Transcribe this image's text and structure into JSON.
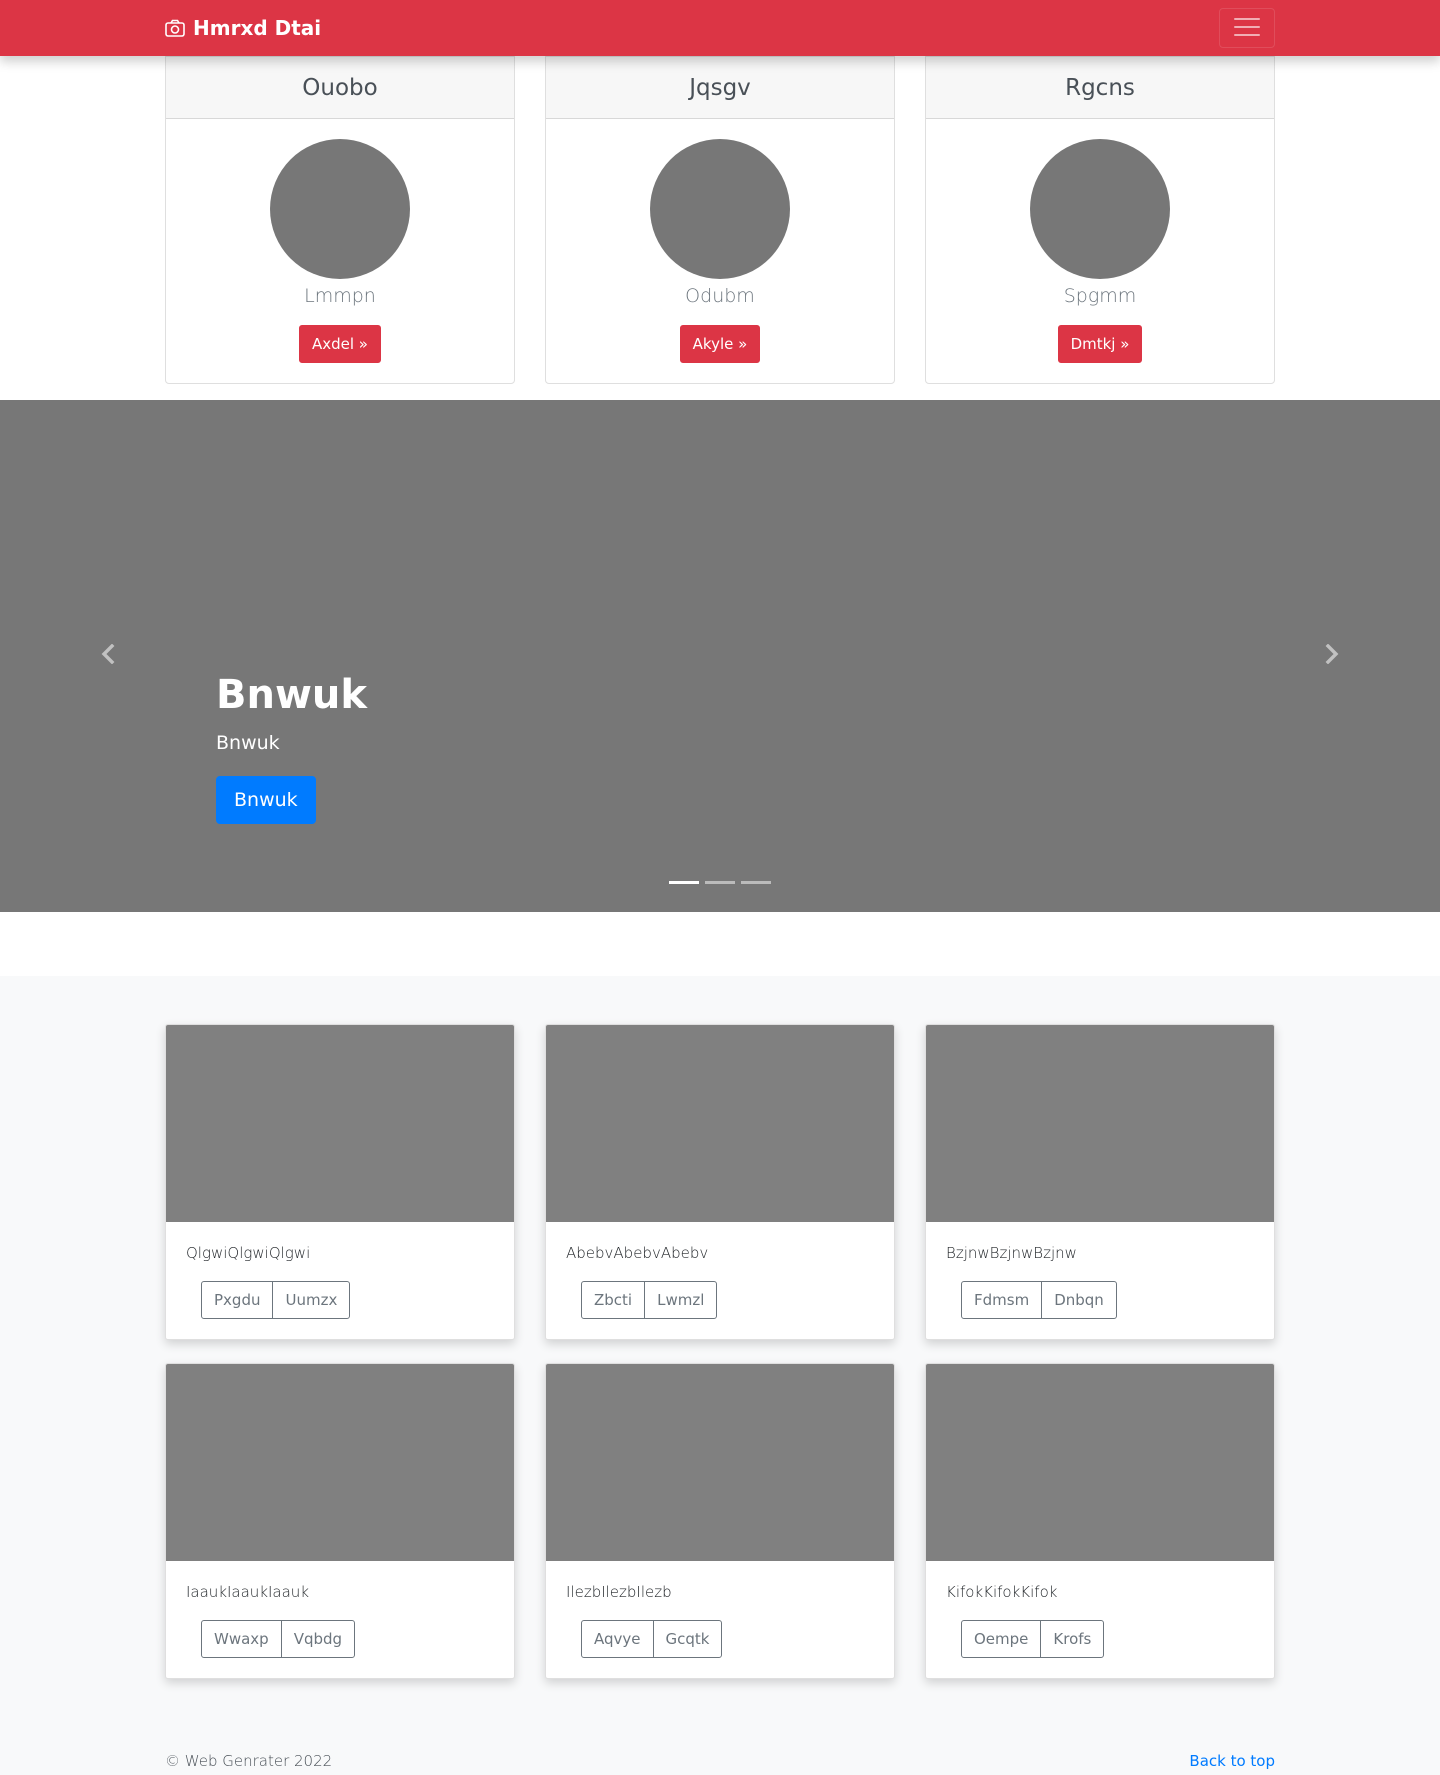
{
  "navbar": {
    "brand": "Hmrxd Dtai",
    "brand_icon": "camera-icon",
    "toggler_icon": "hamburger-menu-icon",
    "color": "#dc3545"
  },
  "profiles": [
    {
      "header": "Ouobo",
      "name": "Lmmpn",
      "button": "Axdel »"
    },
    {
      "header": "Jqsgv",
      "name": "Odubm",
      "button": "Akyle »"
    },
    {
      "header": "Rgcns",
      "name": "Spgmm",
      "button": "Dmtkj »"
    }
  ],
  "carousel": {
    "title": "Bnwuk",
    "text": "Bnwuk",
    "button": "Bnwuk",
    "prev_icon": "chevron-left-icon",
    "next_icon": "chevron-right-icon",
    "slide_count": 3,
    "active_slide": 0
  },
  "album": [
    {
      "text": "QlgwiQlgwiQlgwi",
      "buttons": [
        "Pxgdu",
        "Uumzx"
      ]
    },
    {
      "text": "AbebvAbebvAbebv",
      "buttons": [
        "Zbcti",
        "Lwmzl"
      ]
    },
    {
      "text": "BzjnwBzjnwBzjnw",
      "buttons": [
        "Fdmsm",
        "Dnbqn"
      ]
    },
    {
      "text": "IaaukIaaukIaauk",
      "buttons": [
        "Wwaxp",
        "Vqbdg"
      ]
    },
    {
      "text": "IlezbIlezbIlezb",
      "buttons": [
        "Aqvye",
        "Gcqtk"
      ]
    },
    {
      "text": "KifokKifokKifok",
      "buttons": [
        "Oempe",
        "Krofs"
      ]
    }
  ],
  "footer": {
    "copyright": "© Web Genrater 2022",
    "back_to_top": "Back to top"
  }
}
